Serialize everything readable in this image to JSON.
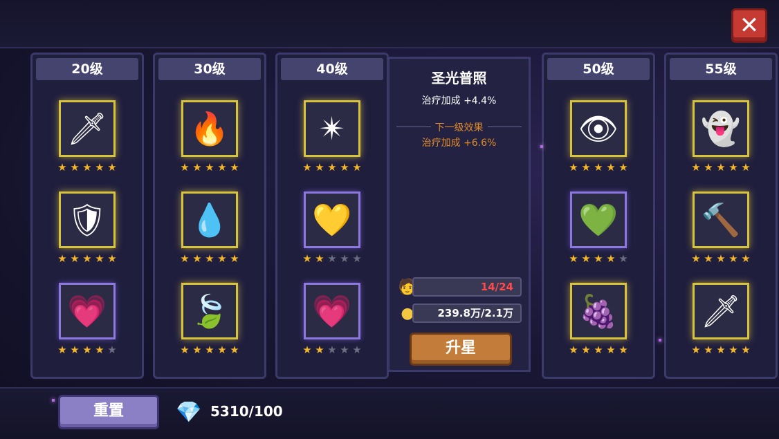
{
  "close_label": "✕",
  "columns": [
    {
      "level": "20级",
      "skills": [
        {
          "icon": "sword-icon",
          "glyph": "🗡",
          "frame": "gold",
          "stars": 5
        },
        {
          "icon": "armor-icon",
          "glyph": "🛡",
          "frame": "gold",
          "stars": 5
        },
        {
          "icon": "heart-icon",
          "glyph": "💗",
          "frame": "purple",
          "stars": 4
        }
      ]
    },
    {
      "level": "30级",
      "skills": [
        {
          "icon": "fire-icon",
          "glyph": "🔥",
          "frame": "gold",
          "stars": 5
        },
        {
          "icon": "water-drop-icon",
          "glyph": "💧",
          "frame": "gold",
          "stars": 5
        },
        {
          "icon": "leaf-icon",
          "glyph": "🍃",
          "frame": "gold",
          "stars": 5
        }
      ]
    },
    {
      "level": "40级",
      "skills": [
        {
          "icon": "holy-light-icon",
          "glyph": "✴",
          "frame": "gold",
          "stars": 5
        },
        {
          "icon": "golden-heart-icon",
          "glyph": "💛",
          "frame": "purple",
          "stars": 2
        },
        {
          "icon": "heart-icon",
          "glyph": "💗",
          "frame": "purple",
          "stars": 2
        }
      ]
    },
    {
      "level": "50级",
      "skills": [
        {
          "icon": "hooded-shadow-icon",
          "glyph": "👁",
          "frame": "gold",
          "stars": 5
        },
        {
          "icon": "green-heart-icon",
          "glyph": "💚",
          "frame": "purple",
          "stars": 4
        },
        {
          "icon": "grape-icon",
          "glyph": "🍇",
          "frame": "gold",
          "stars": 5
        }
      ]
    },
    {
      "level": "55级",
      "skills": [
        {
          "icon": "ghost-icon",
          "glyph": "👻",
          "frame": "gold",
          "stars": 5
        },
        {
          "icon": "hammer-icon",
          "glyph": "🔨",
          "frame": "gold",
          "stars": 5
        },
        {
          "icon": "sword-icon",
          "glyph": "🗡",
          "frame": "gold",
          "stars": 5
        }
      ]
    }
  ],
  "info": {
    "title": "圣光普照",
    "current_effect": "治疗加成 +4.4%",
    "next_label": "下一级效果",
    "next_effect": "治疗加成 +6.6%",
    "fragments": "14/24",
    "coins": "239.8万/2.1万",
    "upgrade_label": "升星"
  },
  "colors": {
    "fragments_text": "#ff4b4b",
    "coins_text": "#ffffff",
    "next_effect": "#e08a2a"
  },
  "footer": {
    "reset_label": "重置",
    "gems": "5310/100"
  }
}
